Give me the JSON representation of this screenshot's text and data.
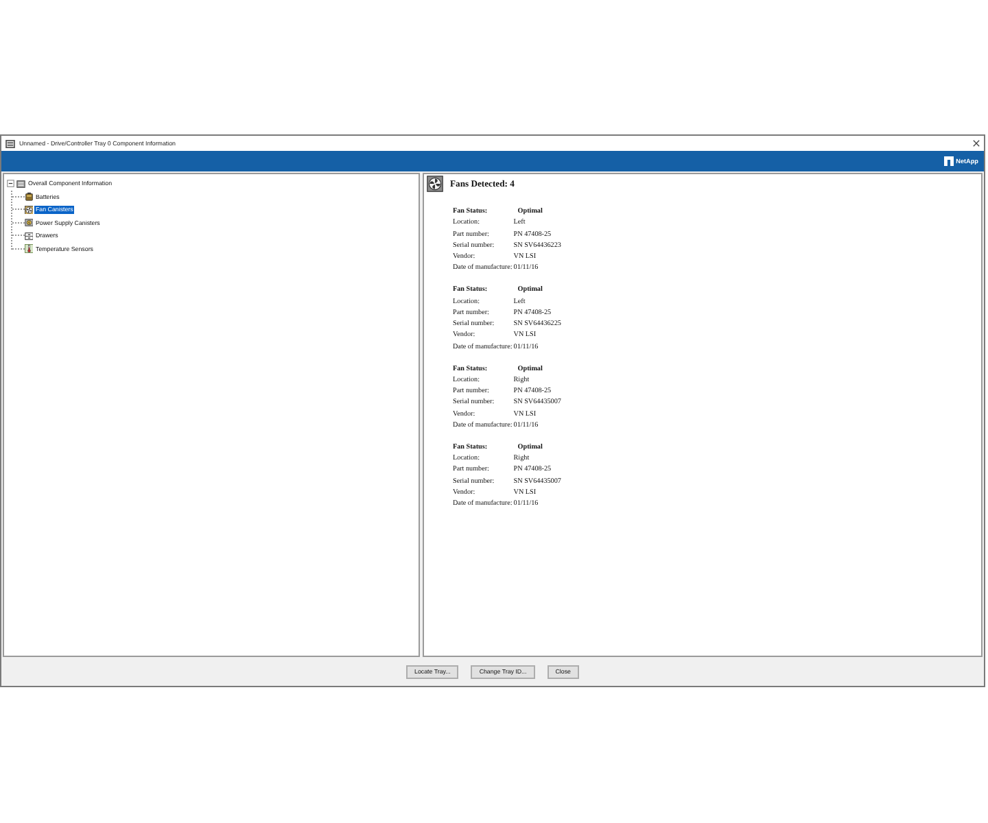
{
  "window": {
    "title": "Unnamed - Drive/Controller Tray 0 Component Information"
  },
  "banner": {
    "brand": "NetApp"
  },
  "tree": {
    "root": {
      "label": "Overall Component Information",
      "expanded": true,
      "selected": false,
      "children": [
        {
          "label": "Batteries",
          "kind": "battery",
          "selected": false
        },
        {
          "label": "Fan Canisters",
          "kind": "fan",
          "selected": true
        },
        {
          "label": "Power Supply Canisters",
          "kind": "power",
          "selected": false
        },
        {
          "label": "Drawers",
          "kind": "drawer",
          "selected": false
        },
        {
          "label": "Temperature Sensors",
          "kind": "thermometer",
          "selected": false
        }
      ]
    }
  },
  "details": {
    "heading": "Fans Detected: 4",
    "fans": [
      {
        "status_label": "Fan Status:",
        "status": "Optimal",
        "fields": [
          {
            "label": "Location:",
            "value": "Left"
          },
          {
            "label": "Part number:",
            "value": "PN 47408-25"
          },
          {
            "label": "Serial number:",
            "value": "SN SV64436223"
          },
          {
            "label": "Vendor:",
            "value": "VN LSI"
          },
          {
            "label": "Date of manufacture:",
            "value": "01/11/16"
          }
        ]
      },
      {
        "status_label": "Fan Status:",
        "status": "Optimal",
        "fields": [
          {
            "label": "Location:",
            "value": "Left"
          },
          {
            "label": "Part number:",
            "value": "PN 47408-25"
          },
          {
            "label": "Serial number:",
            "value": "SN SV64436225"
          },
          {
            "label": "Vendor:",
            "value": "VN LSI"
          },
          {
            "label": "Date of manufacture:",
            "value": "01/11/16"
          }
        ]
      },
      {
        "status_label": "Fan Status:",
        "status": "Optimal",
        "fields": [
          {
            "label": "Location:",
            "value": "Right"
          },
          {
            "label": "Part number:",
            "value": "PN 47408-25"
          },
          {
            "label": "Serial number:",
            "value": "SN SV64435007"
          },
          {
            "label": "Vendor:",
            "value": "VN LSI"
          },
          {
            "label": "Date of manufacture:",
            "value": "01/11/16"
          }
        ]
      },
      {
        "status_label": "Fan Status:",
        "status": "Optimal",
        "fields": [
          {
            "label": "Location:",
            "value": "Right"
          },
          {
            "label": "Part number:",
            "value": "PN 47408-25"
          },
          {
            "label": "Serial number:",
            "value": "SN SV64435007"
          },
          {
            "label": "Vendor:",
            "value": "VN LSI"
          },
          {
            "label": "Date of manufacture:",
            "value": "01/11/16"
          }
        ]
      }
    ]
  },
  "buttons": [
    "Locate Tray...",
    "Change Tray ID...",
    "Close"
  ]
}
